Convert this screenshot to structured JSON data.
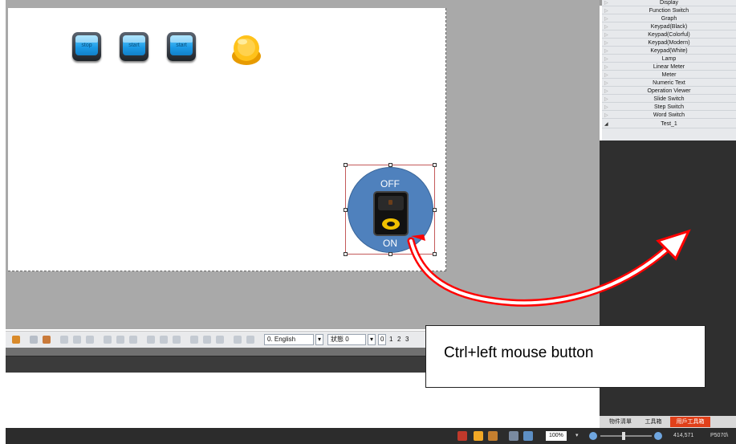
{
  "canvas": {
    "buttons": [
      {
        "label": "stop"
      },
      {
        "label": "start"
      },
      {
        "label": "start"
      }
    ],
    "switch": {
      "off_label": "OFF",
      "on_label": "ON"
    }
  },
  "toolbar": {
    "language_select": "0. English",
    "state_select": "狀態 0",
    "page_select": "0",
    "pages": [
      "1",
      "2",
      "3"
    ]
  },
  "component_list": {
    "items": [
      "Display",
      "Function Switch",
      "Graph",
      "Keypad(Black)",
      "Keypad(Colorful)",
      "Keypad(Modern)",
      "Keypad(White)",
      "Lamp",
      "Linear Meter",
      "Meter",
      "Numeric Text",
      "Operation Viewer",
      "Slide Switch",
      "Step Switch",
      "Word Switch",
      "Test_1"
    ]
  },
  "panel_tabs": [
    "物件清單",
    "工具箱",
    "用戶工具箱"
  ],
  "statusbar": {
    "zoom": "100%",
    "coords": "414,571",
    "model": "P5070\\"
  },
  "annotation": {
    "callout_text": "Ctrl+left mouse button",
    "arrow_color": "#ff0000"
  }
}
